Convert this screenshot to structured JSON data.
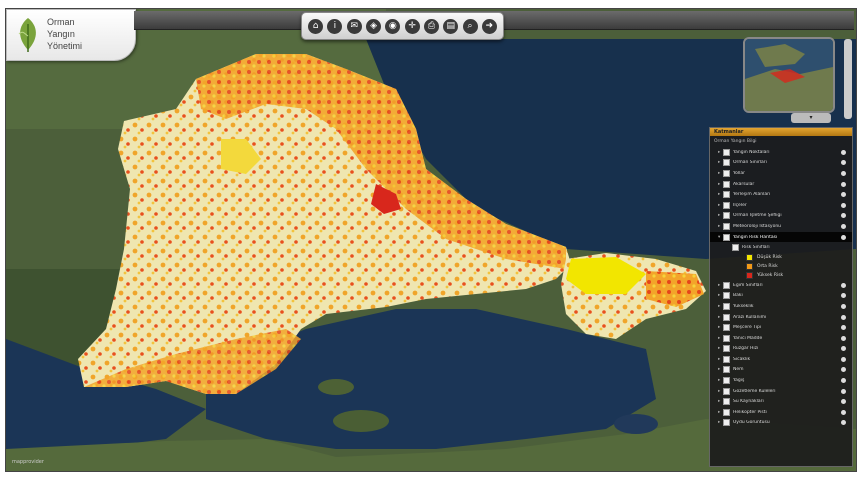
{
  "app": {
    "logo_lines": [
      "Orman",
      "Yangın",
      "Yönetimi"
    ]
  },
  "toolbar": {
    "buttons": [
      {
        "name": "home-icon",
        "glyph": "⌂"
      },
      {
        "name": "info-icon",
        "glyph": "i"
      },
      {
        "name": "chat-icon",
        "glyph": "✉"
      },
      {
        "name": "layers-icon",
        "glyph": "◈"
      },
      {
        "name": "camera-icon",
        "glyph": "◉"
      },
      {
        "name": "gps-icon",
        "glyph": "✛"
      },
      {
        "name": "print-icon",
        "glyph": "⎙"
      },
      {
        "name": "measure-icon",
        "glyph": "▤"
      },
      {
        "name": "search-icon",
        "glyph": "⌕"
      },
      {
        "name": "forward-icon",
        "glyph": "➜"
      }
    ]
  },
  "panel": {
    "title": "Katmanlar",
    "subtitle": "Orman Yangın Bilgi",
    "layers_top": [
      "Yangın Noktaları",
      "Orman Sınırları",
      "Yollar",
      "Akarsular",
      "Yerleşim Alanları",
      "İlçeler",
      "Orman İşletme Şefliği",
      "Meteoroloji İstasyonu"
    ],
    "active_layer": "Yangın Risk Haritası",
    "sub_layer": "Risk Sınıfları",
    "legend": [
      {
        "label": "Düşük Risk",
        "color": "#f2e600"
      },
      {
        "label": "Orta Risk",
        "color": "#f39a18"
      },
      {
        "label": "Yüksek Risk",
        "color": "#d8271c"
      }
    ],
    "layers_bottom": [
      "Eğim Sınıfları",
      "Bakı",
      "Yükseklik",
      "Arazi Kullanımı",
      "Meşcere Tipi",
      "Yanıcı Madde",
      "Rüzgar Hızı",
      "Sıcaklık",
      "Nem",
      "Yağış",
      "Gözetleme Kuleleri",
      "Su Kaynakları",
      "Helikopter Pisti",
      "Uydu Görüntüsü"
    ]
  },
  "attribution": "mapprovider"
}
